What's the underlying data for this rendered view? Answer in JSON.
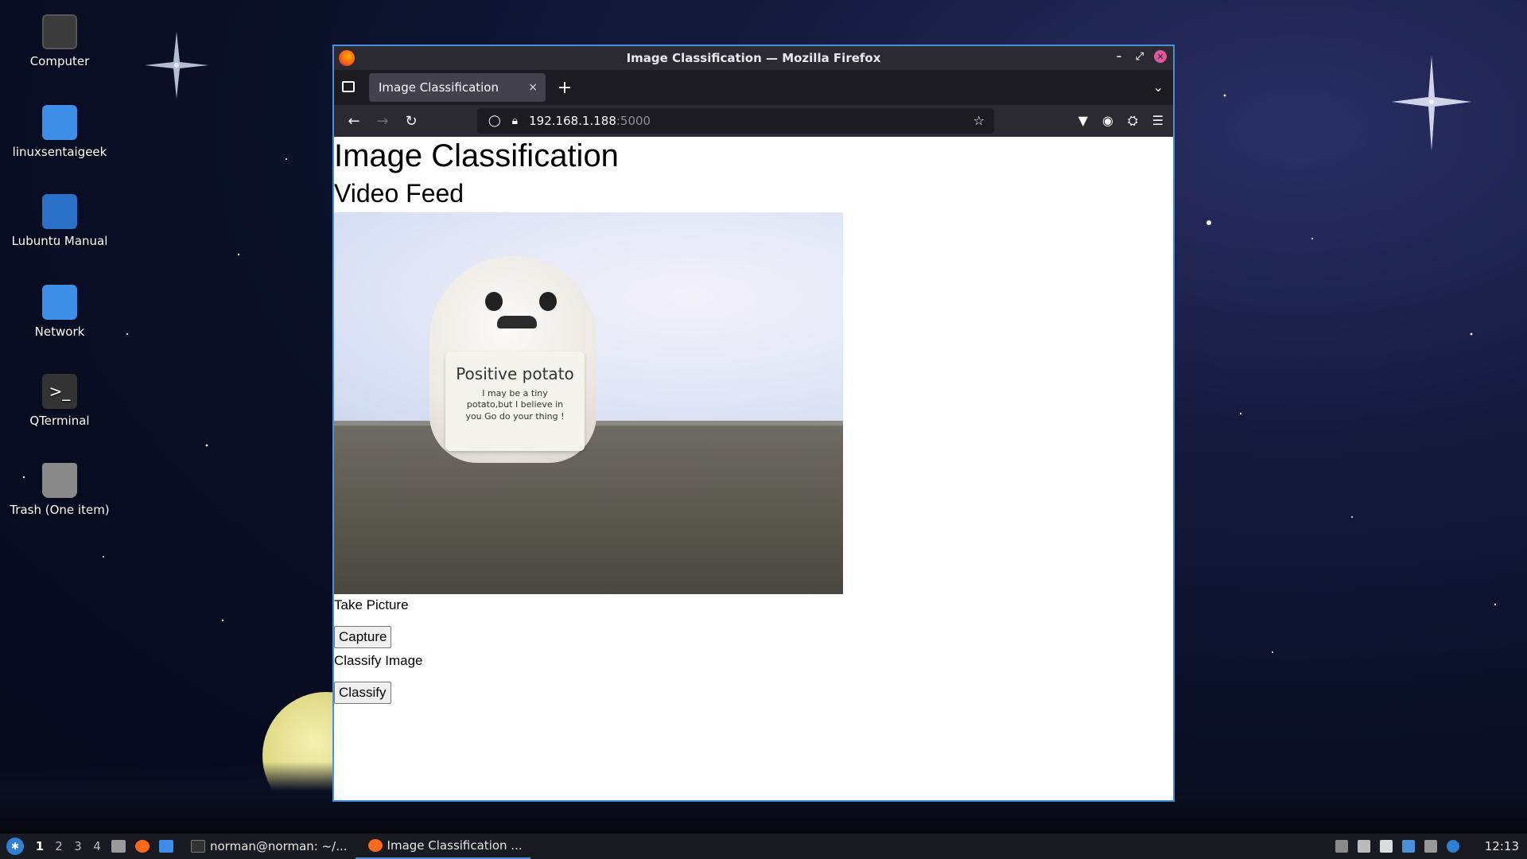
{
  "desktop": {
    "icons": [
      {
        "label": "Computer"
      },
      {
        "label": "linuxsentaigeek"
      },
      {
        "label": "Lubuntu Manual"
      },
      {
        "label": "Network"
      },
      {
        "label": "QTerminal"
      },
      {
        "label": "Trash (One item)"
      }
    ]
  },
  "window": {
    "title": "Image Classification — Mozilla Firefox",
    "tab_title": "Image Classification",
    "tab_close": "×",
    "new_tab": "+",
    "url_host": "192.168.1.188",
    "url_port": ":5000"
  },
  "page": {
    "heading": "Image Classification",
    "subheading": "Video Feed",
    "feed_sign_title": "Positive potato",
    "feed_sign_text": "I may be a tiny potato,but I believe in you Go do your thing !",
    "take_picture_label": "Take Picture",
    "capture_button": "Capture",
    "classify_label": "Classify Image",
    "classify_button": "Classify"
  },
  "taskbar": {
    "workspaces": [
      "1",
      "2",
      "3",
      "4"
    ],
    "active_workspace": "1",
    "tasks": [
      {
        "label": "norman@norman: ~/..."
      },
      {
        "label": "Image Classification ..."
      }
    ],
    "clock": "12:13"
  }
}
